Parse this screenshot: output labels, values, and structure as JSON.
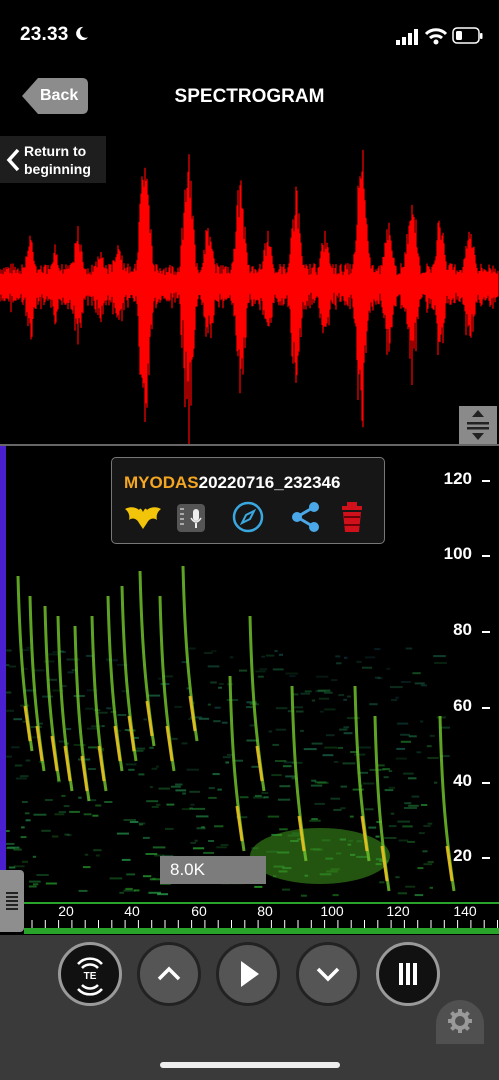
{
  "status": {
    "time": "23.33"
  },
  "nav": {
    "back": "Back",
    "title": "SPECTROGRAM",
    "return_line1": "Return to",
    "return_line2": "beginning"
  },
  "recording": {
    "brand": "MYODAS",
    "name": "20220716_232346"
  },
  "y_axis": {
    "labels": [
      "120",
      "100",
      "80",
      "60",
      "40",
      "20"
    ]
  },
  "x_axis": {
    "labels": [
      "20",
      "40",
      "60",
      "80",
      "100",
      "120",
      "140"
    ]
  },
  "readout": "8.0K",
  "colors": {
    "waveform": "#ff0000",
    "brand": "#f5a623",
    "compass": "#3aa8e0",
    "share": "#4aa8e8",
    "trash": "#d0101a",
    "bat": "#f2c40a",
    "marker_bar": "#4a1fd0"
  },
  "controls": [
    "time-expansion-icon",
    "chevron-up-icon",
    "play-icon",
    "chevron-down-icon",
    "pause-icon"
  ]
}
